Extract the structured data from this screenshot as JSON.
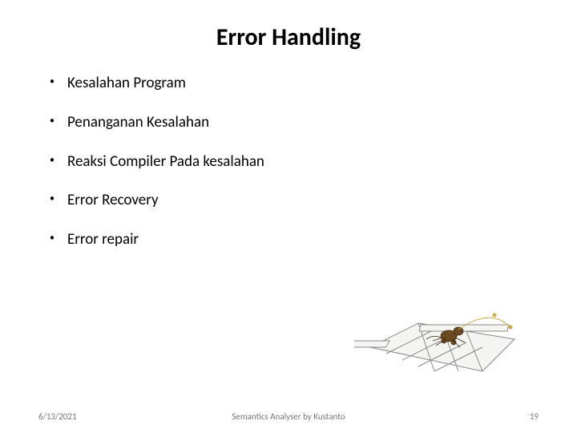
{
  "title": "Error Handling",
  "bullets": [
    "Kesalahan Program",
    "Penanganan Kesalahan",
    "Reaksi Compiler Pada kesalahan",
    "Error Recovery",
    "Error repair"
  ],
  "footer": {
    "date": "6/13/2021",
    "author": "Semantics Analyser by Kustanto",
    "page": "19"
  }
}
